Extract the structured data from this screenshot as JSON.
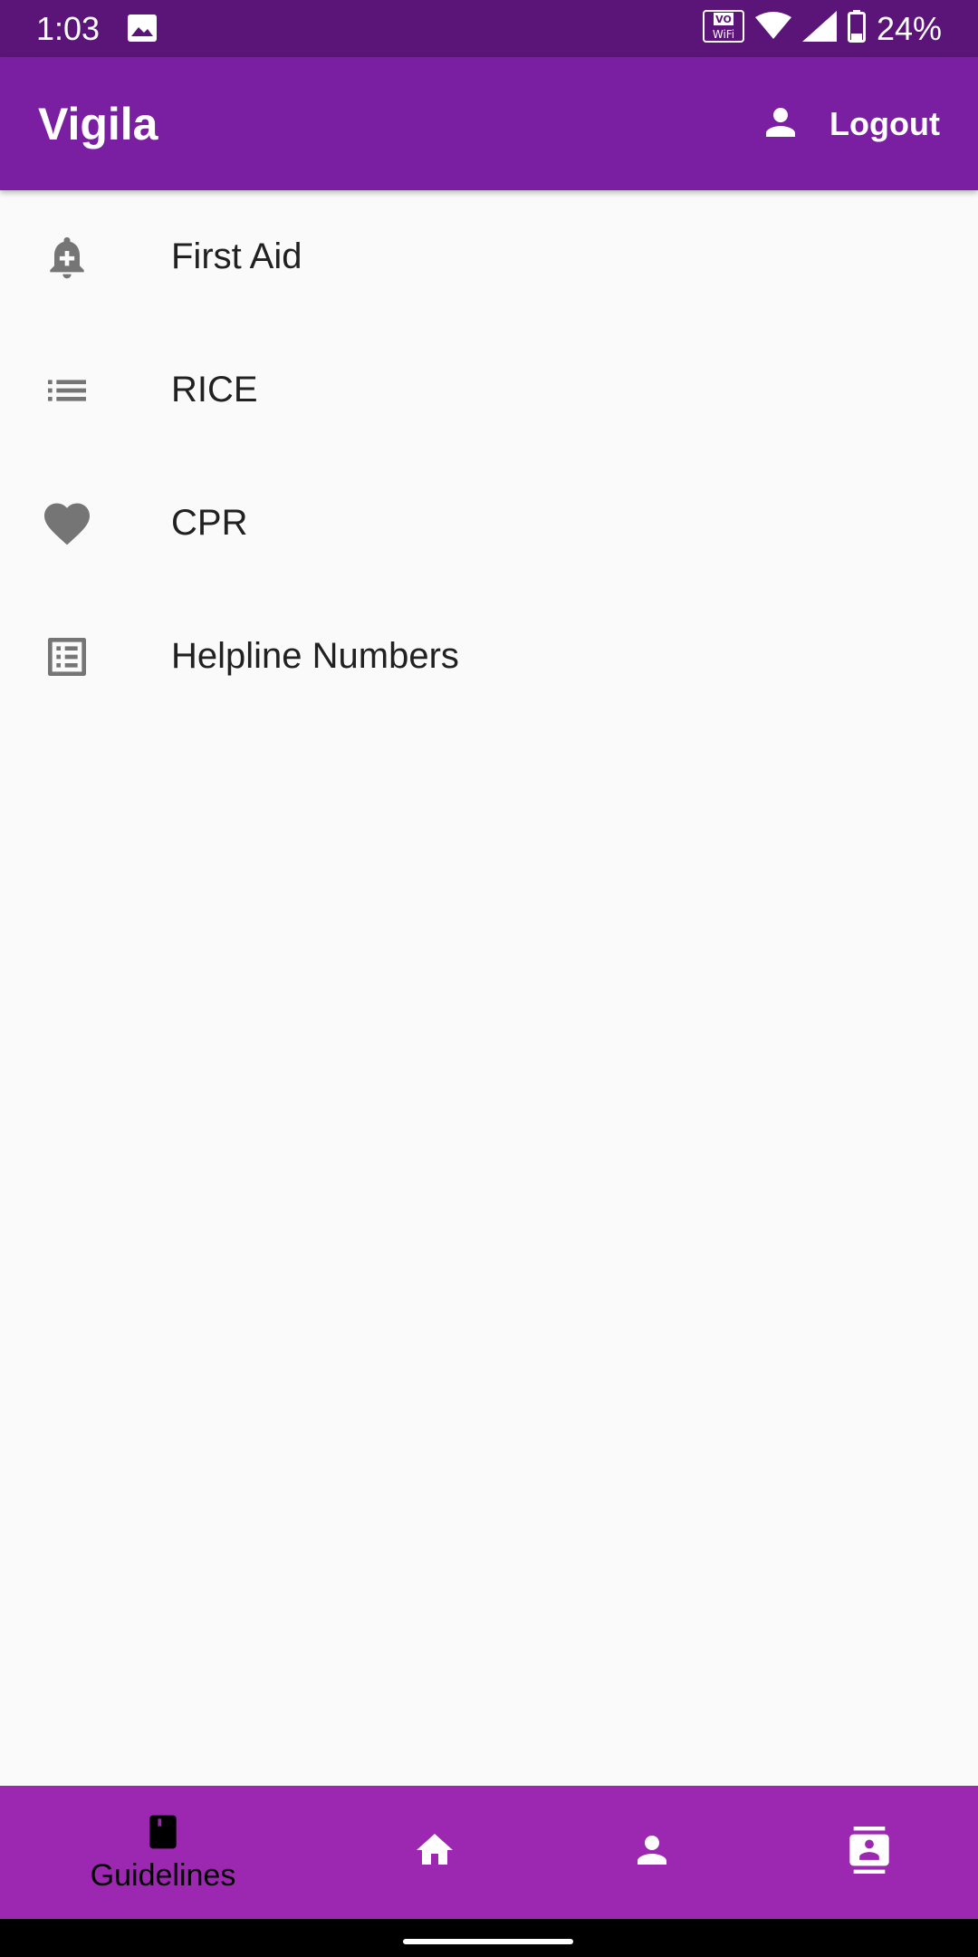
{
  "status_bar": {
    "time": "1:03",
    "battery": "24%",
    "icons": [
      "image-icon",
      "vowifi-icon",
      "wifi-icon",
      "signal-icon",
      "battery-icon"
    ]
  },
  "app_bar": {
    "title": "Vigila",
    "logout_label": "Logout",
    "logout_icon": "person-icon",
    "color": "#7b1fa2"
  },
  "menu": {
    "items": [
      {
        "label": "First Aid",
        "icon": "bell-plus-icon"
      },
      {
        "label": "RICE",
        "icon": "list-icon"
      },
      {
        "label": "CPR",
        "icon": "heart-icon"
      },
      {
        "label": "Helpline Numbers",
        "icon": "list-alt-icon"
      }
    ],
    "icon_color": "#757575",
    "text_color": "#212121"
  },
  "bottom_nav": {
    "color": "#9c27b0",
    "items": [
      {
        "label": "Guidelines",
        "icon": "book-icon",
        "active": true
      },
      {
        "label": "",
        "icon": "home-icon",
        "active": false
      },
      {
        "label": "",
        "icon": "person-icon",
        "active": false
      },
      {
        "label": "",
        "icon": "contacts-icon",
        "active": false
      }
    ]
  }
}
